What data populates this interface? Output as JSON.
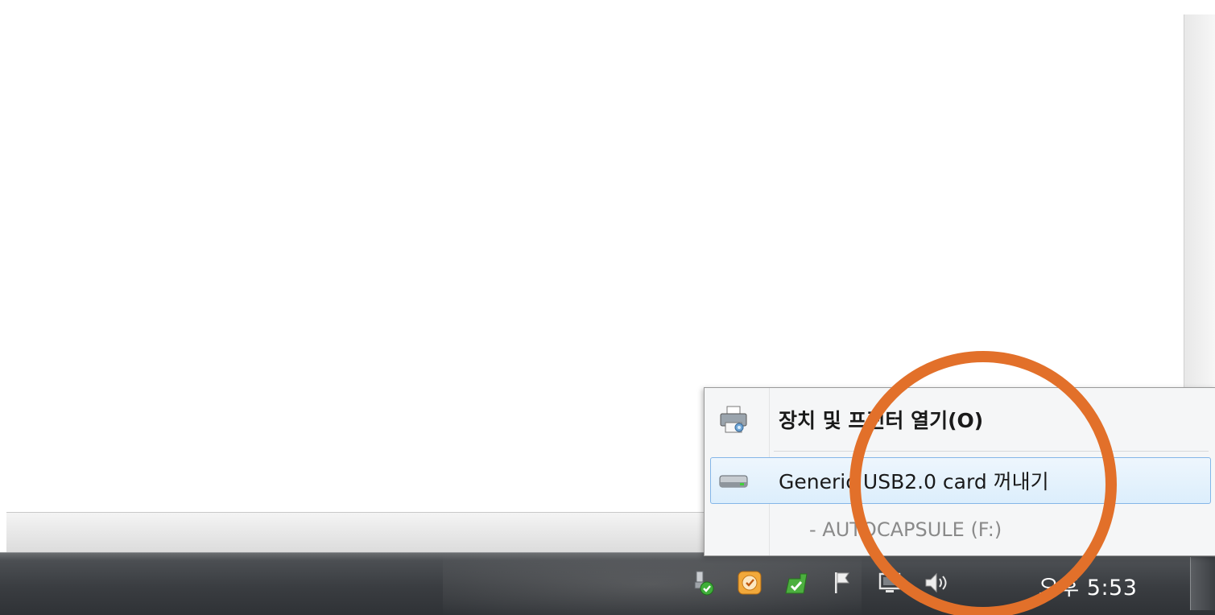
{
  "menu": {
    "devices_label": "장치 및 프린터 열기(O)",
    "eject_label": "Generic USB2.0 card 꺼내기",
    "volume_label": "- AUTOCAPSULE (F:)",
    "icons": {
      "devices": "printer-icon",
      "eject": "drive-icon"
    }
  },
  "taskbar": {
    "clock": "오후 5:53",
    "tray_icons": [
      "safely-remove-hardware-icon",
      "security-shield-icon",
      "update-check-icon",
      "action-center-flag-icon",
      "network-icon",
      "volume-icon"
    ]
  },
  "colors": {
    "highlight_border": "#84b6e8",
    "annotation": "#e2702a",
    "taskbar": "#3a3d41"
  }
}
